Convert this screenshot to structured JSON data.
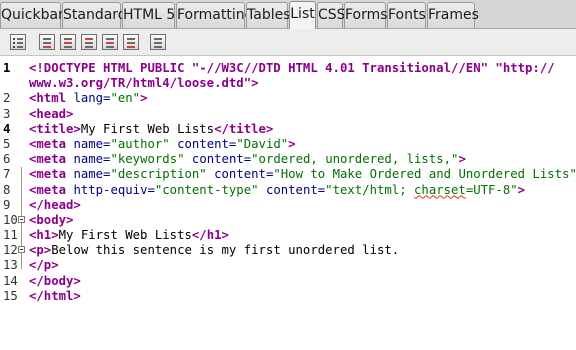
{
  "tabs": [
    {
      "id": "quickbar",
      "label": "Quickbar"
    },
    {
      "id": "standard",
      "label": "Standard"
    },
    {
      "id": "html5",
      "label": "HTML 5"
    },
    {
      "id": "formatting",
      "label": "Formatting"
    },
    {
      "id": "tables",
      "label": "Tables"
    },
    {
      "id": "list",
      "label": "List",
      "active": true
    },
    {
      "id": "css",
      "label": "CSS"
    },
    {
      "id": "forms",
      "label": "Forms"
    },
    {
      "id": "fonts",
      "label": "Fonts"
    },
    {
      "id": "frames",
      "label": "Frames"
    }
  ],
  "toolbar": {
    "buttons": [
      {
        "name": "unordered-list-icon"
      },
      {
        "name": "ordered-list-icon"
      },
      {
        "name": "list-item-icon"
      },
      {
        "name": "definition-list-icon"
      },
      {
        "name": "definition-term-icon"
      },
      {
        "name": "definition-description-icon"
      }
    ]
  },
  "colors": {
    "tag": "#8b008b",
    "attribute": "#000080",
    "value": "#007000",
    "error_underline": "#e03030"
  },
  "editor": {
    "line_numbers": [
      "1",
      "",
      "2",
      "3",
      "4",
      "5",
      "6",
      "7",
      "8",
      "9",
      "10",
      "11",
      "12",
      "13",
      "14",
      "15"
    ],
    "lines": {
      "l1a": "<!DOCTYPE HTML PUBLIC \"-//W3C//DTD HTML 4.01 Transitional//EN\" \"http://",
      "l1b": "www.w3.org/TR/html4/loose.dtd\">",
      "l2_tag_open": "<html",
      "l2_attr": "lang=",
      "l2_val": "\"en\"",
      "l2_close": ">",
      "l3": "<head>",
      "l4_open": "<title>",
      "l4_text": "My First Web Lists",
      "l4_close": "</title>",
      "l5_tag": "<meta",
      "l5_attr1": "name=",
      "l5_val1": "\"author\"",
      "l5_attr2": "content=",
      "l5_val2": "\"David\"",
      "l5_close": ">",
      "l6_tag": "<meta",
      "l6_attr1": "name=",
      "l6_val1": "\"keywords\"",
      "l6_attr2": "content=",
      "l6_val2": "\"ordered, unordered, lists,\"",
      "l6_close": ">",
      "l7_tag": "<meta",
      "l7_attr1": "name=",
      "l7_val1": "\"description\"",
      "l7_attr2": "content=",
      "l7_val2": "\"How to Make Ordered and Unordered Lists\"",
      "l7_close": ">",
      "l8_tag": "<meta",
      "l8_attr1": "http-equiv=",
      "l8_val1": "\"content-type\"",
      "l8_attr2": "content=",
      "l8_val2a": "\"text/html;",
      "l8_val2b": "charset",
      "l8_val2c": "=UTF-8\"",
      "l8_close": ">",
      "l9": "</head>",
      "l10": "<body>",
      "l11_open": "<h1>",
      "l11_text": "My First Web Lists",
      "l11_close": "</h1>",
      "l12_open": "<p>",
      "l12_text": "Below this sentence is my first unordered list.",
      "l13": "</p>",
      "l14": "</body>",
      "l15": "</html>"
    }
  }
}
